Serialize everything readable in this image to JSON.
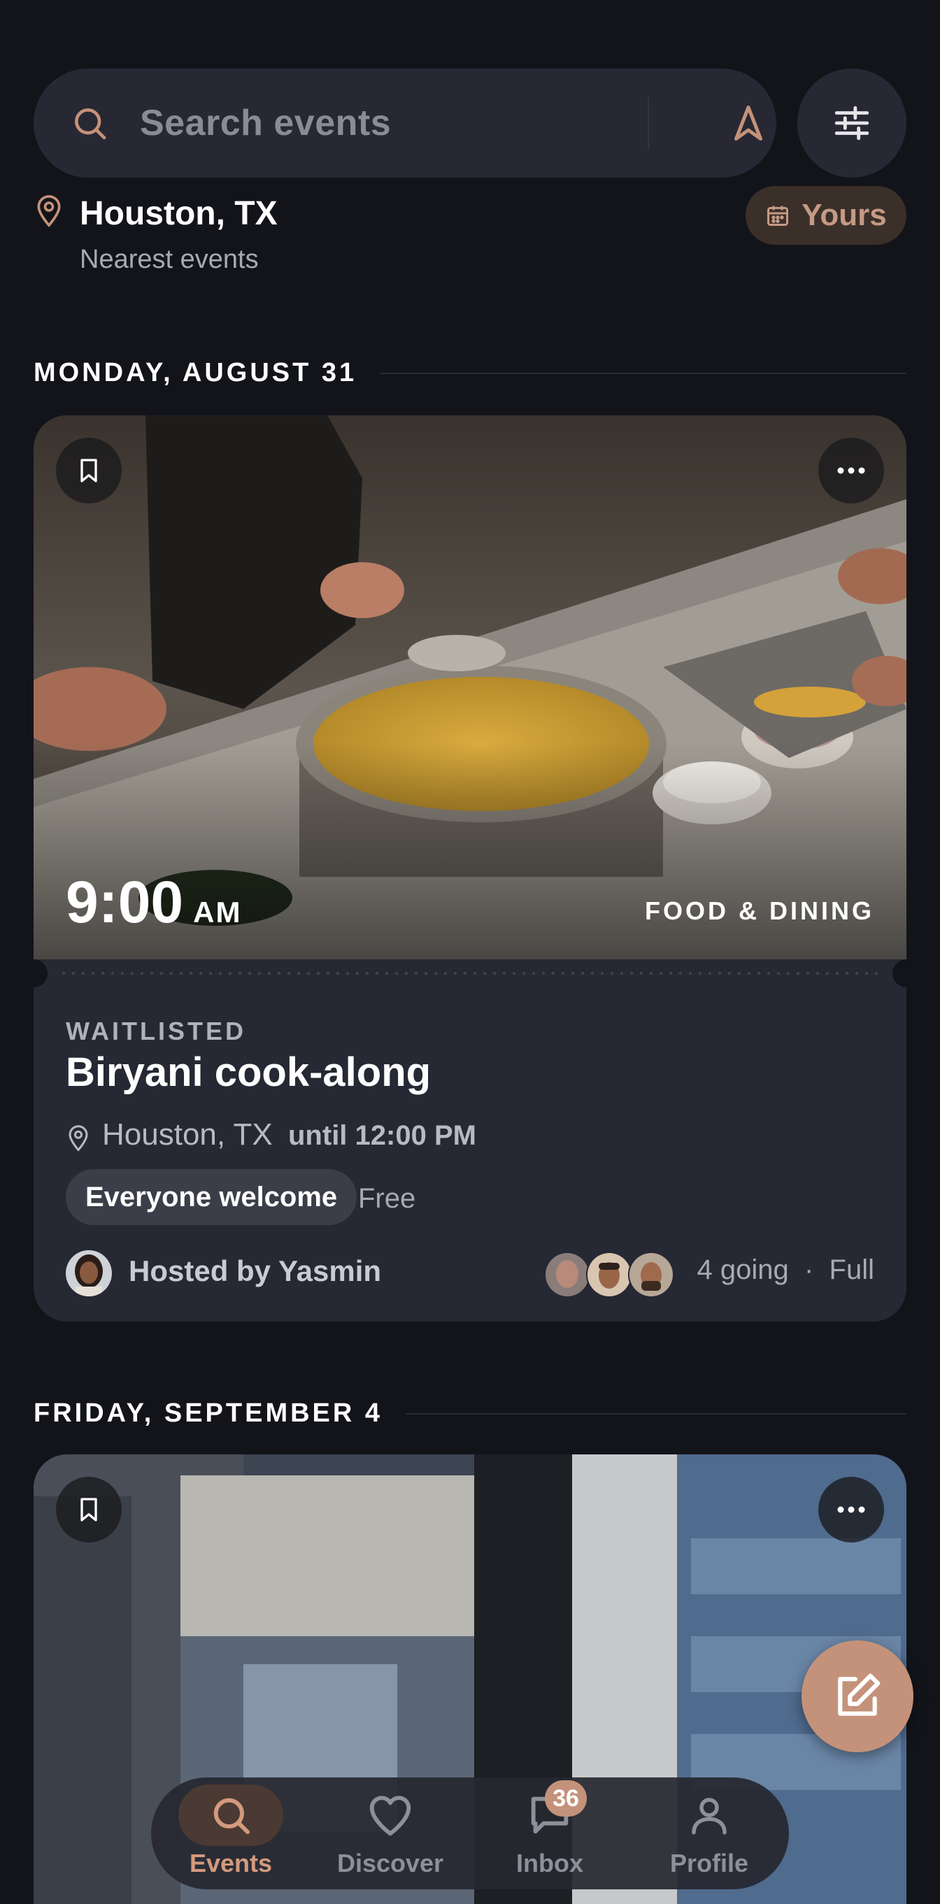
{
  "search": {
    "placeholder": "Search events"
  },
  "location": {
    "city": "Houston, TX",
    "subtitle": "Nearest events",
    "yours_label": "Yours"
  },
  "sections": [
    {
      "date": "MONDAY, AUGUST 31",
      "event": {
        "time": "9:00",
        "ampm": "AM",
        "category": "FOOD & DINING",
        "status": "WAITLISTED",
        "title": "Biryani cook-along",
        "place": "Houston, TX",
        "until": "until 12:00 PM",
        "audience": "Everyone welcome",
        "price": "Free",
        "host": "Hosted by Yasmin",
        "going": "4 going",
        "capacity": "Full"
      }
    },
    {
      "date": "FRIDAY, SEPTEMBER 4"
    }
  ],
  "nav": {
    "items": [
      {
        "label": "Events",
        "icon": "search-icon",
        "active": true
      },
      {
        "label": "Discover",
        "icon": "heart-icon",
        "active": false
      },
      {
        "label": "Inbox",
        "icon": "chat-icon",
        "active": false,
        "badge": "36"
      },
      {
        "label": "Profile",
        "icon": "person-icon",
        "active": false
      }
    ]
  },
  "colors": {
    "background": "#13141a",
    "surface": "#262833",
    "accent": "#c4927a"
  }
}
